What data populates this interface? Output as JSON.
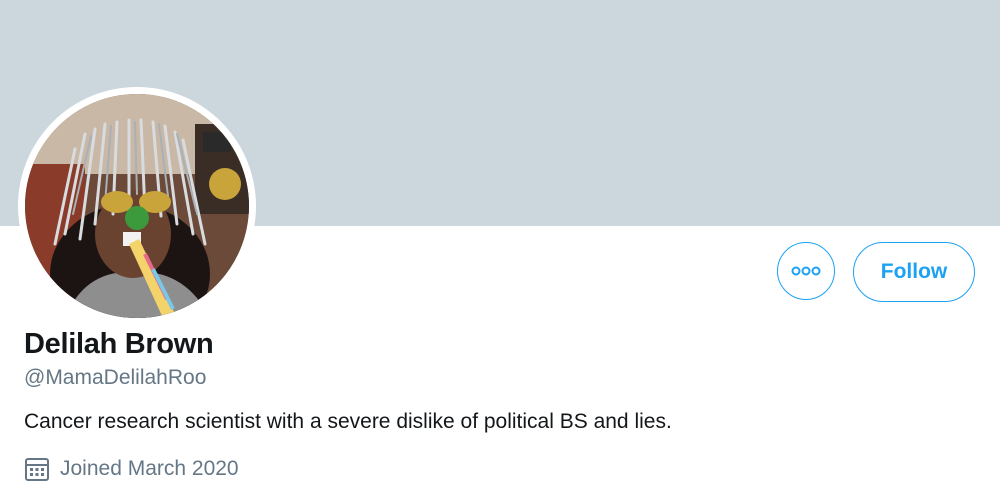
{
  "profile": {
    "display_name": "Delilah Brown",
    "handle": "@MamaDelilahRoo",
    "bio": "Cancer research scientist with a severe dislike of political BS and lies.",
    "joined": "Joined March 2020"
  },
  "actions": {
    "more_icon": "more-horizontal-icon",
    "follow_label": "Follow"
  },
  "icons": {
    "joined": "calendar-icon"
  },
  "colors": {
    "accent": "#1da1f2",
    "banner": "#ccd6dd",
    "secondary_text": "#657786",
    "primary_text": "#14171a"
  }
}
